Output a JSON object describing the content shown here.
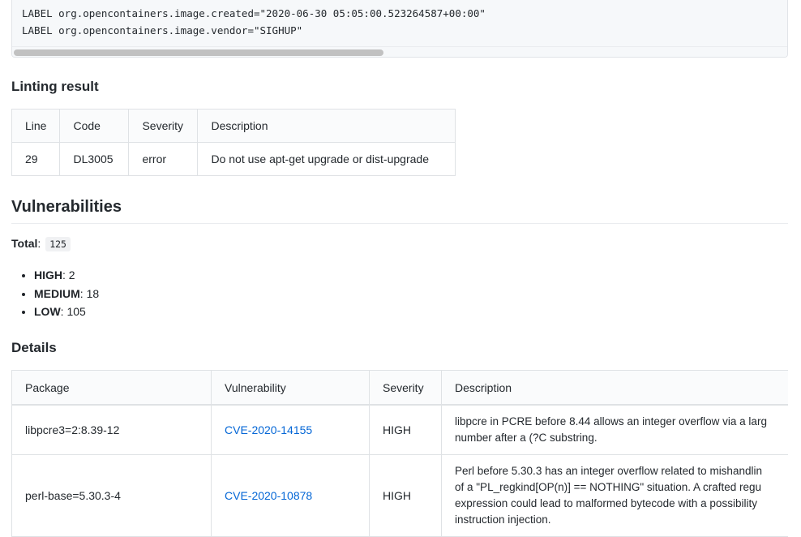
{
  "code_lines": [
    "LABEL org.opencontainers.image.created=\"2020-06-30 05:05:00.523264587+00:00\"",
    "LABEL org.opencontainers.image.vendor=\"SIGHUP\""
  ],
  "linting": {
    "heading": "Linting result",
    "headers": [
      "Line",
      "Code",
      "Severity",
      "Description"
    ],
    "rows": [
      {
        "line": "29",
        "code": "DL3005",
        "severity": "error",
        "description": "Do not use apt-get upgrade or dist-upgrade"
      }
    ]
  },
  "vulnerabilities": {
    "heading": "Vulnerabilities",
    "total_label": "Total",
    "total_value": "125",
    "counts": [
      {
        "level": "HIGH",
        "value": "2"
      },
      {
        "level": "MEDIUM",
        "value": "18"
      },
      {
        "level": "LOW",
        "value": "105"
      }
    ]
  },
  "details": {
    "heading": "Details",
    "headers": [
      "Package",
      "Vulnerability",
      "Severity",
      "Description"
    ],
    "rows": [
      {
        "package": "libpcre3=2:8.39-12",
        "cve": "CVE-2020-14155",
        "severity": "HIGH",
        "description_lines": [
          "libpcre in PCRE before 8.44 allows an integer overflow via a larg",
          "number after a (?C substring."
        ]
      },
      {
        "package": "perl-base=5.30.3-4",
        "cve": "CVE-2020-10878",
        "severity": "HIGH",
        "description_lines": [
          "Perl before 5.30.3 has an integer overflow related to mishandlin",
          "of a \"PL_regkind[OP(n)] == NOTHING\" situation. A crafted regu",
          "expression could lead to malformed bytecode with a possibility",
          "instruction injection."
        ]
      }
    ]
  },
  "colors": {
    "link": "#0366d6",
    "border": "#dfe2e5",
    "code_bg": "#f6f8fa"
  }
}
